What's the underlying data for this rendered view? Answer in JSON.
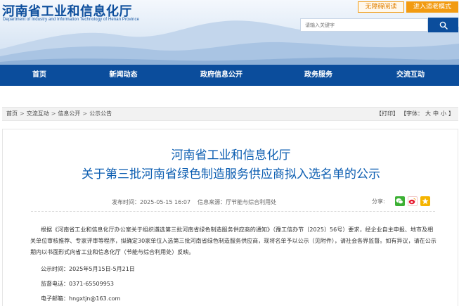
{
  "header": {
    "site_title": "河南省工业和信息化厅",
    "site_subtitle": "Department of Industry and Information Technology of Henan Province",
    "accessible_label": "无障碍阅读",
    "elder_mode_label": "进入适老模式",
    "search_placeholder": "请输入关键字",
    "search_icon": "search-icon"
  },
  "nav": {
    "items": [
      {
        "label": "首页"
      },
      {
        "label": "新闻动态"
      },
      {
        "label": "政府信息公开"
      },
      {
        "label": "政务服务"
      },
      {
        "label": "交流互动"
      }
    ]
  },
  "breadcrumb": {
    "items": [
      "首页",
      "交流互动",
      "信息公开",
      "公示公告"
    ],
    "separator": ">",
    "print_label": "【打印】",
    "font_label": "【字体：",
    "font_large": "大",
    "font_medium": "中",
    "font_small": "小",
    "font_close": "】"
  },
  "article": {
    "title_line1": "河南省工业和信息化厅",
    "title_line2": "关于第三批河南省绿色制造服务供应商拟入选名单的公示",
    "publish_time": "发布时间：2025-05-15 16:07",
    "source": "信息来源：厅节能与综合利用处",
    "share_label": "分享:",
    "share_icons": [
      "wechat-icon",
      "weibo-icon",
      "qzone-icon"
    ],
    "body_paragraph": "根据《河南省工业和信息化厅办公室关于组织遴选第三批河南省绿色制造服务供应商的通知》（豫工信办节〔2025〕56号）要求，经企业自主申报、地市及相关单位审核推荐、专家评审等程序，拟确定30家单位入选第三批河南省绿色制造服务供应商，现将名单予以公示（见附件），请社会各界监督。如有异议，请在公示期内以书面形式向省工业和信息化厅（节能与综合利用处）反映。",
    "period": "公示时间：2025年5月15日-5月21日",
    "phone": "监督电话：0371-65509953",
    "email": "电子邮箱：hngxtjn@163.com"
  },
  "colors": {
    "primary_blue": "#0b4d9c",
    "title_blue": "#0b5db1",
    "accent_orange": "#f29b11",
    "wechat_green": "#3cb034",
    "weibo_red": "#e6162d",
    "qzone_yellow": "#f5b400"
  }
}
